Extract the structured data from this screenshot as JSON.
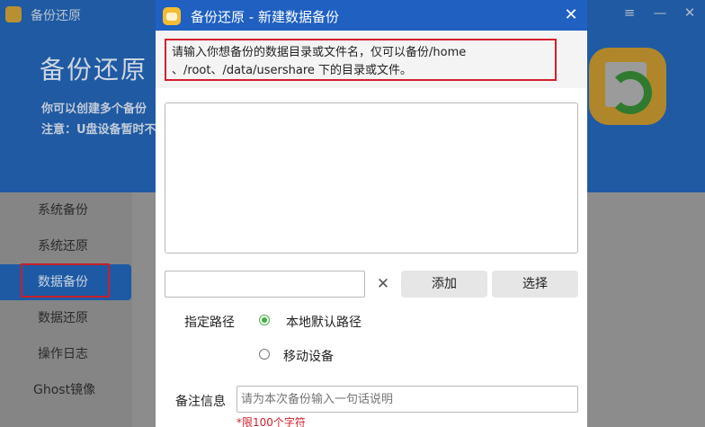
{
  "main_window": {
    "app_name": "备份还原",
    "title": "备份还原",
    "desc_line1": "你可以创建多个备份",
    "desc_line2": "注意：U盘设备暂时不",
    "menu_icon": "≡",
    "minimize_icon": "—",
    "close_icon": "✕",
    "sidebar": {
      "items": [
        {
          "label": "系统备份"
        },
        {
          "label": "系统还原"
        },
        {
          "label": "数据备份"
        },
        {
          "label": "数据还原"
        },
        {
          "label": "操作日志"
        },
        {
          "label": "Ghost镜像"
        }
      ],
      "active_index": 2
    }
  },
  "dialog": {
    "title": "备份还原 - 新建数据备份",
    "close_icon": "✕",
    "hint": "请输入你想备份的数据目录或文件名，仅可以备份/home 、/root、/data/usershare 下的目录或文件。",
    "path_input_value": "",
    "clear_icon": "✕",
    "add_label": "添加",
    "select_label": "选择",
    "dest_label": "指定路径",
    "option_local": "本地默认路径",
    "option_mobile": "移动设备",
    "selected_option": "本地默认路径",
    "note_label": "备注信息",
    "note_placeholder": "请为本次备份输入一句话说明",
    "limit_text": "*限100个字符"
  },
  "colors": {
    "title_bar": "#1f60c0",
    "hint_border": "#d4202c",
    "radio_checked": "#3fae3f",
    "limit_text": "#d0202b"
  }
}
